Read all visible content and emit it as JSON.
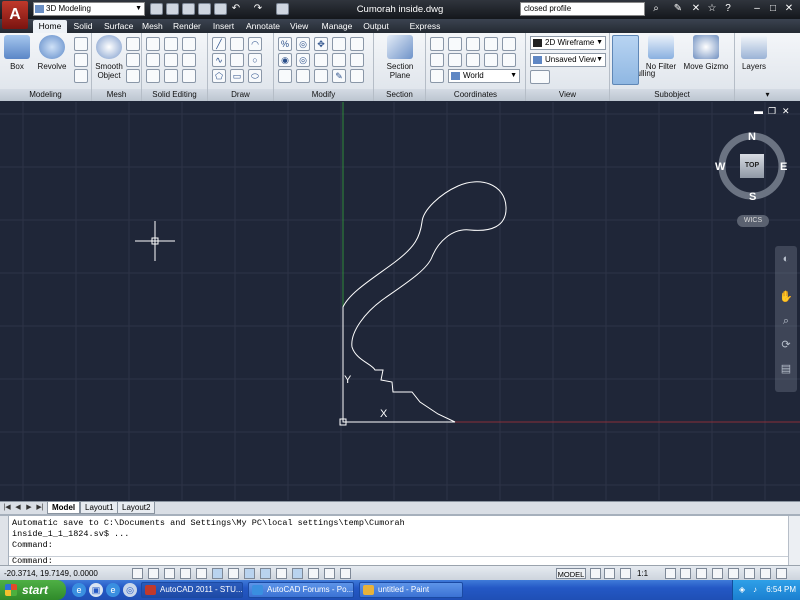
{
  "app": {
    "logo": "A",
    "workspace": "3D Modeling",
    "document_title": "Cumorah inside.dwg",
    "search_value": "closed profile"
  },
  "ribbon": {
    "tabs": [
      "Home",
      "Solid",
      "Surface",
      "Mesh",
      "Render",
      "Insert",
      "Annotate",
      "View",
      "Manage",
      "Output",
      "Express Tools"
    ],
    "panels": {
      "modeling": {
        "label": "Modeling",
        "box": "Box",
        "revolve": "Revolve"
      },
      "mesh": {
        "label": "Mesh",
        "smooth_object": "Smooth Object"
      },
      "solid_editing": {
        "label": "Solid Editing"
      },
      "draw": {
        "label": "Draw"
      },
      "modify": {
        "label": "Modify"
      },
      "section": {
        "label": "Section",
        "section_plane": "Section Plane"
      },
      "coordinates": {
        "label": "Coordinates",
        "ucs": "World"
      },
      "view": {
        "label": "View",
        "visual_style": "2D Wireframe",
        "saved_view": "Unsaved View"
      },
      "subobject": {
        "label": "Subobject",
        "culling": "Culling",
        "no_filter": "No Filter",
        "move_gizmo": "Move Gizmo"
      },
      "layers": {
        "label": "Layers"
      }
    }
  },
  "viewport": {
    "viewcube": {
      "top": "TOP",
      "n": "N",
      "s": "S",
      "e": "E",
      "w": "W",
      "wcs": "WICS"
    },
    "ucs_y": "Y",
    "ucs_x": "X",
    "colors": {
      "background": "#1f2638",
      "grid": "#2d3447",
      "profile": "#ffffff",
      "y_axis": "#2f8a3a",
      "x_axis": "#8a2f38"
    }
  },
  "layout_tabs": [
    "Model",
    "Layout1",
    "Layout2"
  ],
  "command": {
    "history": [
      "Automatic save to C:\\Documents and Settings\\My PC\\local settings\\temp\\Cumorah",
      "inside_1_1_1824.sv$ ...",
      "Command:"
    ],
    "prompt": "Command:"
  },
  "status": {
    "coords": "-20.3714, 19.7149, 0.0000",
    "model": "MODEL",
    "scale": "1:1"
  },
  "taskbar": {
    "start": "start",
    "tasks": [
      "AutoCAD 2011 - STU...",
      "AutoCAD Forums - Po...",
      "untitled - Paint"
    ],
    "clock": "6:54 PM"
  }
}
